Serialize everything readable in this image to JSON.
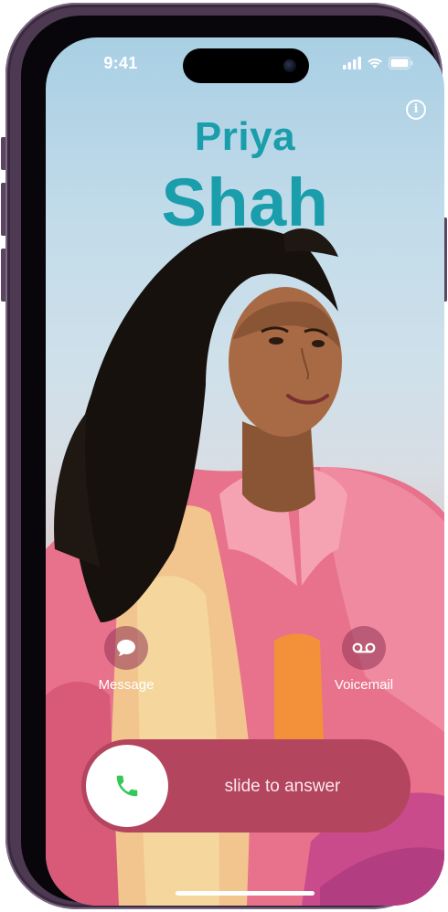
{
  "status_bar": {
    "time": "9:41"
  },
  "caller": {
    "first_name": "Priya",
    "last_name": "Shah"
  },
  "info_button": {
    "glyph": "i"
  },
  "actions": {
    "message": {
      "label": "Message"
    },
    "voicemail": {
      "label": "Voicemail"
    }
  },
  "slider": {
    "text": "slide to answer"
  },
  "colors": {
    "name": "#1a9eab",
    "answer_green": "#34c759",
    "slider_bg": "#b3455f"
  },
  "icons": [
    "cellular-signal-icon",
    "wifi-icon",
    "battery-icon",
    "info-icon",
    "message-bubble-icon",
    "voicemail-icon",
    "phone-icon"
  ]
}
